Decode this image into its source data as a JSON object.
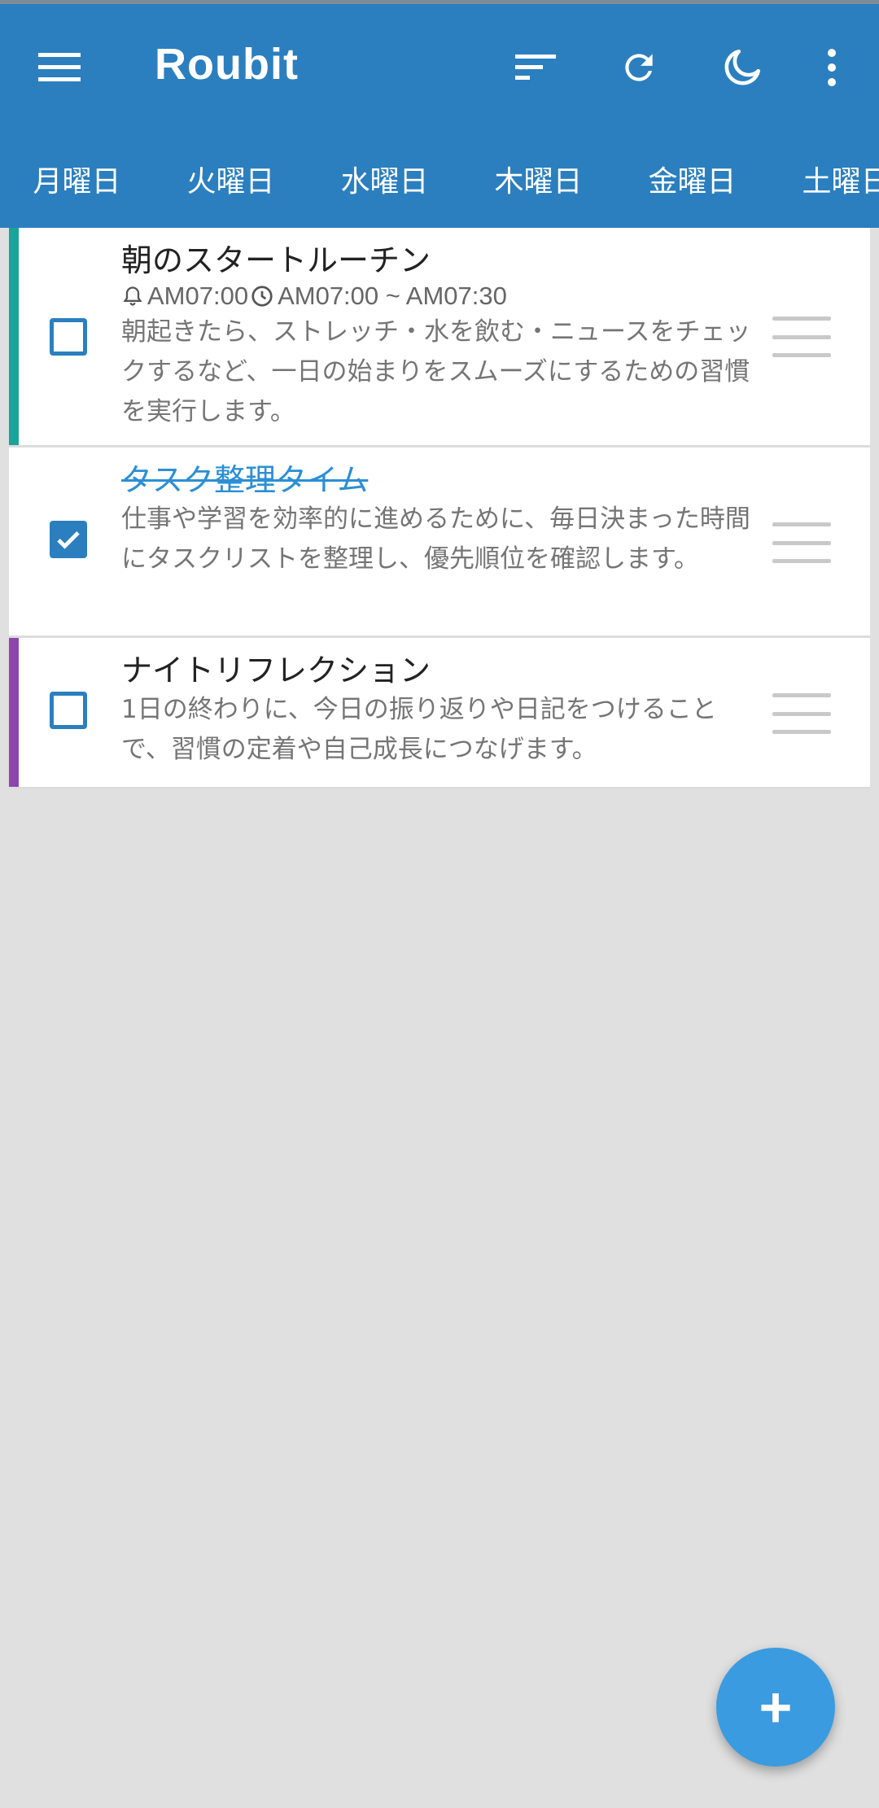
{
  "app": {
    "title": "Roubit",
    "bar_color": "#2b7fbf"
  },
  "toolbar": {
    "icons": [
      "menu-icon",
      "sort-icon",
      "refresh-icon",
      "moon-icon",
      "more-vert-icon"
    ]
  },
  "tabs": [
    {
      "label": "月曜日",
      "active": false
    },
    {
      "label": "火曜日",
      "active": false
    },
    {
      "label": "水曜日",
      "active": true
    },
    {
      "label": "木曜日",
      "active": false
    },
    {
      "label": "金曜日",
      "active": false
    },
    {
      "label": "土曜日",
      "active": false
    }
  ],
  "tasks": [
    {
      "title": "朝のスタートルーチン",
      "checked": false,
      "stripe_color": "#1aa39a",
      "alarm": "AM07:00",
      "time_range": "AM07:00 ~ AM07:30",
      "description": "朝起きたら、ストレッチ・水を飲む・ニュースをチェックするなど、一日の始まりをスムーズにするための習慣を実行します。"
    },
    {
      "title": "タスク整理タイム",
      "checked": true,
      "stripe_color": "",
      "description": "仕事や学習を効率的に進めるために、毎日決まった時間にタスクリストを整理し、優先順位を確認します。"
    },
    {
      "title": "ナイトリフレクション",
      "checked": false,
      "stripe_color": "#8e44ad",
      "description": "1日の終わりに、今日の振り返りや日記をつけることで、習慣の定着や自己成長につなげます。"
    }
  ],
  "fab": {
    "label": "+",
    "color": "#3a9be0"
  }
}
